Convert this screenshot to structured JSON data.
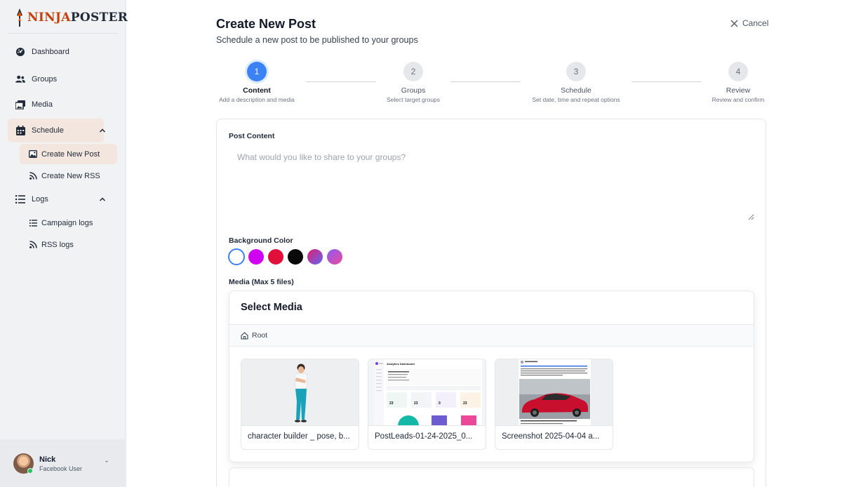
{
  "brand": {
    "logo_accent": "NINJA",
    "logo_rest": "POSTER"
  },
  "sidebar": {
    "items": [
      {
        "label": "Dashboard",
        "icon": "dashboard-icon"
      },
      {
        "label": "Groups",
        "icon": "users-icon"
      },
      {
        "label": "Media",
        "icon": "images-icon"
      },
      {
        "label": "Schedule",
        "icon": "calendar-icon",
        "expanded": true
      },
      {
        "label": "Logs",
        "icon": "list-icon",
        "expanded": true
      }
    ],
    "schedule_sub": [
      {
        "label": "Create New Post",
        "icon": "image-icon",
        "active": true
      },
      {
        "label": "Create New RSS",
        "icon": "rss-icon"
      }
    ],
    "logs_sub": [
      {
        "label": "Campaign logs",
        "icon": "list-icon"
      },
      {
        "label": "RSS logs",
        "icon": "rss-icon"
      }
    ]
  },
  "user": {
    "name": "Nick",
    "role": "Facebook User",
    "status_color": "#22c55e"
  },
  "header": {
    "title": "Create New Post",
    "subtitle": "Schedule a new post to be published to your groups",
    "cancel_label": "Cancel"
  },
  "steps": [
    {
      "number": "1",
      "title": "Content",
      "desc": "Add a description and media",
      "active": true
    },
    {
      "number": "2",
      "title": "Groups",
      "desc": "Select target groups"
    },
    {
      "number": "3",
      "title": "Schedule",
      "desc": "Set date, time and repeat options"
    },
    {
      "number": "4",
      "title": "Review",
      "desc": "Review and confirm"
    }
  ],
  "form": {
    "content_label": "Post Content",
    "content_placeholder": "What would you like to share to your groups?",
    "content_value": "",
    "bg_label": "Background Color",
    "colors": [
      "#ffffff",
      "#d000f0",
      "#e0103a",
      "#0a0a0a",
      "linear-gradient(135deg,#e11d74,#6366f1)",
      "linear-gradient(135deg,#8b5cf6,#ec4899)"
    ],
    "selected_color": "#ffffff",
    "media_label": "Media (Max 5 files)"
  },
  "media": {
    "title": "Select Media",
    "crumb": "Root",
    "files": [
      {
        "name": "character builder _ pose, b..."
      },
      {
        "name": "PostLeads-01-24-2025_0..."
      },
      {
        "name": "Screenshot 2025-04-04 a..."
      }
    ],
    "dashboard_preview": {
      "title": "Analytics Dashboard",
      "stats": [
        "23",
        "23",
        "0",
        "23"
      ]
    }
  },
  "colors": {
    "accent": "#3b82f6",
    "active_nav": "#f2e6df",
    "brand_orange": "#c2410c"
  }
}
